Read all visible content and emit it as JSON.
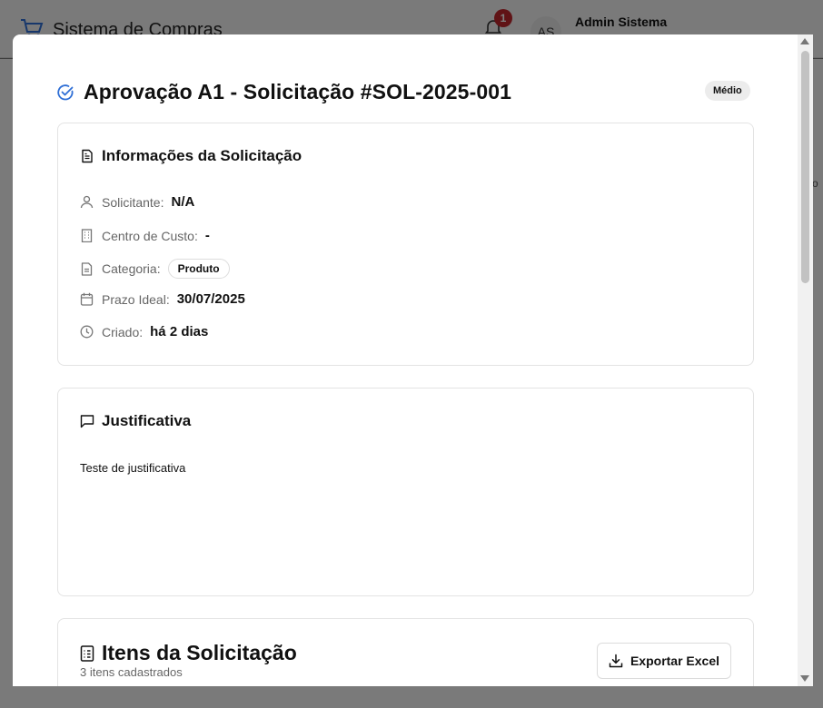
{
  "app": {
    "title": "Sistema de Compras",
    "notification_count": "1",
    "user_initials": "AS",
    "user_name": "Admin Sistema"
  },
  "modal": {
    "title": "Aprovação A1 - Solicitação #SOL-2025-001",
    "priority": "Médio",
    "info_card": {
      "title": "Informações da Solicitação",
      "rows": [
        {
          "icon": "user-icon",
          "label": "Solicitante:",
          "value": "N/A"
        },
        {
          "icon": "building-icon",
          "label": "Centro de Custo:",
          "value": "-"
        },
        {
          "icon": "document-icon",
          "label": "Categoria:",
          "value": "Produto"
        },
        {
          "icon": "calendar-icon",
          "label": "Prazo Ideal:",
          "value": "30/07/2025"
        },
        {
          "icon": "clock-icon",
          "label": "Criado:",
          "value": "há 2 dias"
        }
      ]
    },
    "justification_card": {
      "title": "Justificativa",
      "text": "Teste de justificativa"
    },
    "items_card": {
      "title": "Itens da Solicitação",
      "subtitle": "3 itens cadastrados",
      "export_label": "Exportar Excel"
    }
  },
  "colors": {
    "accent": "#2f6fd6",
    "badge_red": "#c0262d",
    "overlay": "#7a7a7a"
  }
}
